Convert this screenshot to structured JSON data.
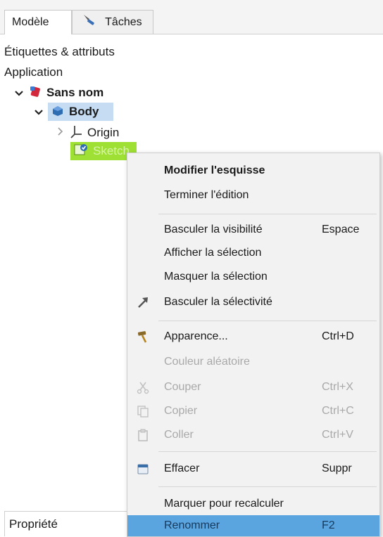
{
  "tabs": {
    "model": "Modèle",
    "tasks": "Tâches"
  },
  "tree": {
    "section_title": "Étiquettes & attributs",
    "application": "Application",
    "document": "Sans nom",
    "body": "Body",
    "origin": "Origin",
    "sketch": "Sketch"
  },
  "property_header": "Propriété",
  "menu": {
    "edit_sketch": "Modifier l'esquisse",
    "finish_edit": "Terminer l'édition",
    "toggle_visibility": "Basculer la visibilité",
    "toggle_visibility_key": "Espace",
    "show_selection": "Afficher la sélection",
    "hide_selection": "Masquer la sélection",
    "toggle_selectivity": "Basculer la sélectivité",
    "appearance": "Apparence...",
    "appearance_key": "Ctrl+D",
    "random_color": "Couleur aléatoire",
    "cut": "Couper",
    "cut_key": "Ctrl+X",
    "copy": "Copier",
    "copy_key": "Ctrl+C",
    "paste": "Coller",
    "paste_key": "Ctrl+V",
    "delete": "Effacer",
    "delete_key": "Suppr",
    "mark_recompute": "Marquer pour recalculer",
    "rename": "Renommer",
    "rename_key": "F2"
  },
  "colors": {
    "body_selection": "#c5dcf2",
    "sketch_selection": "#9ee033",
    "menu_hover": "#5aa5e0",
    "menu_background": "#f2f2f2"
  }
}
